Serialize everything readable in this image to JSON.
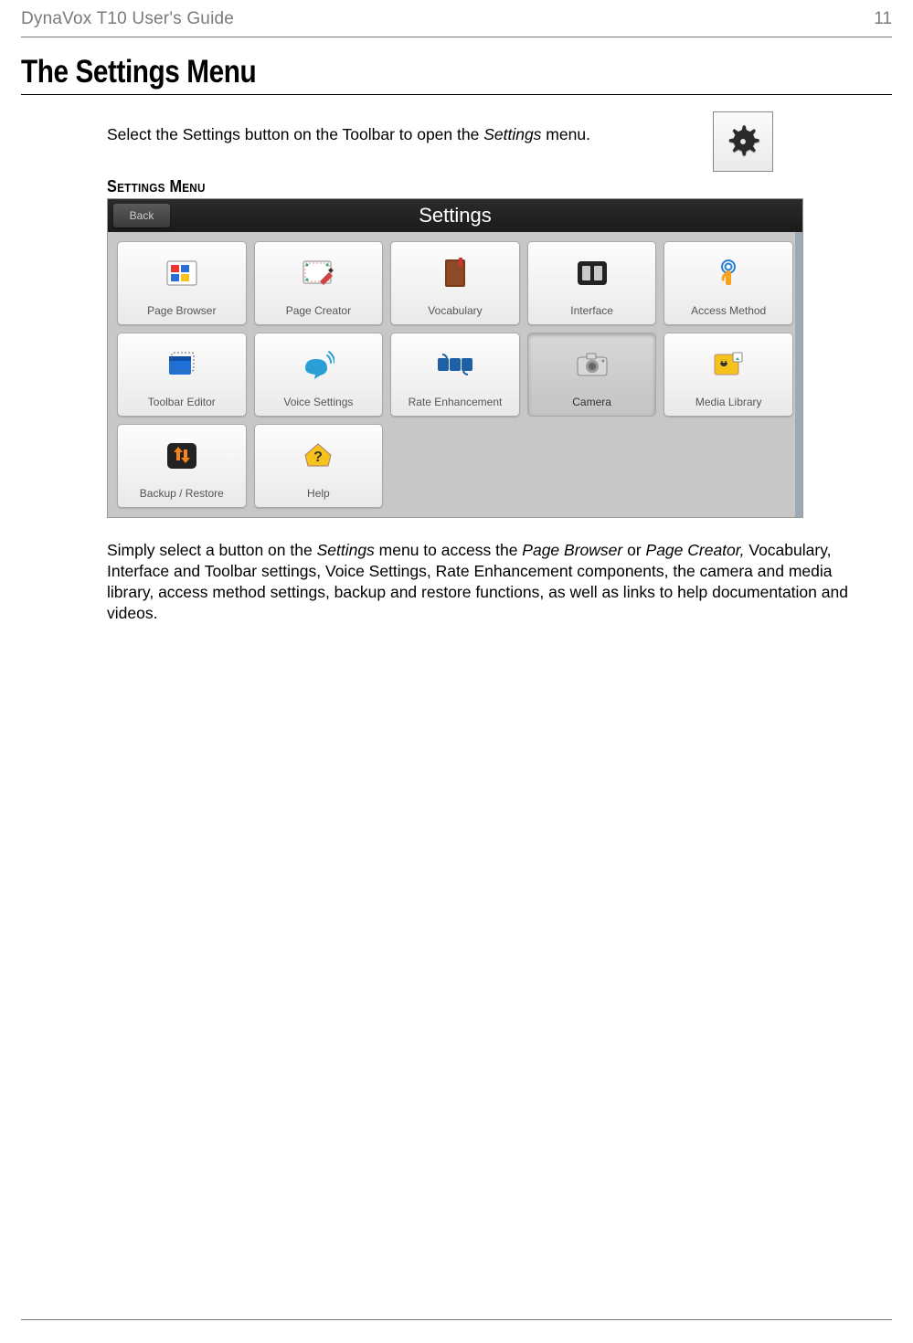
{
  "header": {
    "guide_title": "DynaVox T10 User's Guide",
    "page_number": "11"
  },
  "section": {
    "title": "The Settings Menu",
    "intro_prefix": "Select the Settings button on the Toolbar to open the ",
    "intro_italic": "Settings",
    "intro_suffix": " menu.",
    "sub_head": "Settings Menu"
  },
  "screenshot": {
    "back_label": "Back",
    "title": "Settings",
    "tiles": [
      {
        "label": "Page Browser",
        "icon": "page-browser-icon"
      },
      {
        "label": "Page Creator",
        "icon": "page-creator-icon"
      },
      {
        "label": "Vocabulary",
        "icon": "vocabulary-icon"
      },
      {
        "label": "Interface",
        "icon": "interface-icon"
      },
      {
        "label": "Access Method",
        "icon": "access-method-icon"
      },
      {
        "label": "Toolbar Editor",
        "icon": "toolbar-editor-icon"
      },
      {
        "label": "Voice Settings",
        "icon": "voice-settings-icon"
      },
      {
        "label": "Rate Enhancement",
        "icon": "rate-enhancement-icon"
      },
      {
        "label": "Camera",
        "icon": "camera-icon",
        "pressed": true
      },
      {
        "label": "Media Library",
        "icon": "media-library-icon"
      },
      {
        "label": "Backup / Restore",
        "icon": "backup-restore-icon"
      },
      {
        "label": "Help",
        "icon": "help-icon"
      }
    ]
  },
  "paragraph": {
    "p1": "Simply select a button on the ",
    "p2_i": "Settings",
    "p3": " menu to access the ",
    "p4_i": "Page Browser",
    "p5": " or ",
    "p6_i": "Page Creator,",
    "p7": " Vocabulary, Interface and Toolbar settings, Voice Settings, Rate Enhancement components, the camera and media library, access method settings, backup and restore functions, as well as links to help documentation and videos."
  }
}
